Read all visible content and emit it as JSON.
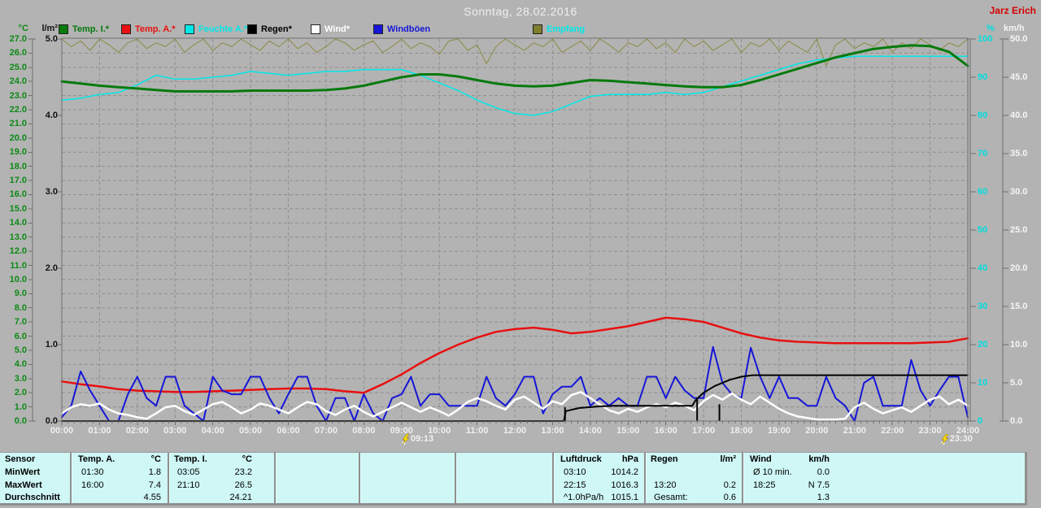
{
  "header": {
    "title": "Sonntag, 28.02.2016",
    "watermark": "Jarz Erich"
  },
  "legend": {
    "items": [
      {
        "label": "Temp. I.*",
        "color": "#067a0c",
        "text_color": "#067a0c"
      },
      {
        "label": "Temp. A.*",
        "color": "#e81010",
        "text_color": "#e81010"
      },
      {
        "label": "Feuchte A.*",
        "color": "#00e8e8",
        "text_color": "#00e8e8"
      },
      {
        "label": "Regen*",
        "color": "#000000",
        "text_color": "#000000"
      },
      {
        "label": "Wind*",
        "color": "#ffffff",
        "text_color": "#ffffff"
      },
      {
        "label": "Windböen",
        "color": "#1616d8",
        "text_color": "#1616d8"
      },
      {
        "label": "Empfang",
        "color": "#7e7e2e",
        "text_color": "#00e8e8"
      }
    ]
  },
  "axes": {
    "left_temp": {
      "unit": "°C",
      "min": 0,
      "max": 27,
      "step": 1,
      "decimals": 1,
      "color": "#0d8a16"
    },
    "left_rain": {
      "unit": "l/m²",
      "min": 0,
      "max": 5,
      "step": 1,
      "decimals": 1,
      "color": "#111111"
    },
    "right_pct": {
      "unit": "%",
      "min": 0,
      "max": 100,
      "step": 10,
      "decimals": 0,
      "color": "#00dede"
    },
    "right_wind": {
      "unit": "km/h",
      "min": 0,
      "max": 50,
      "step": 5,
      "decimals": 1,
      "color": "#f5f5f5"
    },
    "x_time": {
      "min": 0,
      "max": 24,
      "step": 1,
      "suffix": ":00"
    }
  },
  "markers": [
    {
      "label": "09:13",
      "t": 9.22
    },
    {
      "label": "23:30",
      "t": 23.5
    }
  ],
  "chart_data": {
    "type": "line",
    "title": "Sonntag, 28.02.2016",
    "x_unit": "hours",
    "x_range": [
      0,
      24
    ],
    "grid": {
      "x_step_hours": 1,
      "y_step_temp_c": 1
    },
    "scales": {
      "temp": {
        "min": 0,
        "max": 27
      },
      "rain": {
        "min": 0,
        "max": 5
      },
      "pct": {
        "min": 0,
        "max": 100
      },
      "wind": {
        "min": 0,
        "max": 50
      }
    },
    "series": [
      {
        "name": "Empfang",
        "scale": "pct",
        "color": "#8b8b44",
        "width": 1,
        "interval_min": 15,
        "values": [
          100,
          98,
          99.5,
          97,
          100,
          98.5,
          96.5,
          99,
          100,
          97.5,
          99,
          98,
          100,
          96.5,
          98.5,
          100,
          97,
          99,
          98,
          100,
          98.5,
          97,
          99.5,
          98,
          100,
          97.5,
          99,
          96.5,
          98,
          100,
          99,
          97,
          98.5,
          99.5,
          96.5,
          98,
          100,
          97.5,
          99,
          98,
          96,
          99.5,
          100,
          97,
          98.5,
          93.5,
          98,
          100,
          98.5,
          97,
          99,
          98,
          100,
          96.5,
          98,
          99.5,
          97,
          100,
          98.5,
          96.5,
          99,
          98,
          100,
          97.5,
          99,
          96.5,
          100,
          98,
          99.5,
          97,
          98.5,
          100,
          96.5,
          99,
          98,
          100,
          97,
          99.5,
          98,
          96.5,
          100,
          93,
          98.5,
          100,
          97.5,
          99,
          98,
          100,
          96.5,
          99,
          97.5,
          100,
          98.5,
          97,
          99,
          98,
          100
        ]
      },
      {
        "name": "Feuchte A.",
        "scale": "pct",
        "color": "#00e8e8",
        "width": 1.5,
        "interval_min": 30,
        "values": [
          84,
          84.5,
          85.5,
          86,
          88,
          90.5,
          89.5,
          89.5,
          90,
          90.5,
          91.5,
          91,
          90.5,
          91,
          91.5,
          91.5,
          92,
          92,
          92,
          90.5,
          88.5,
          86.5,
          84,
          82,
          80.5,
          80,
          81,
          83,
          85,
          85.5,
          85.5,
          85.5,
          86,
          85.5,
          86,
          87.5,
          89,
          90.5,
          92,
          93.5,
          94.5,
          95,
          95.5,
          95.5,
          95.5,
          95.5,
          95.5,
          95.5,
          95.5
        ]
      },
      {
        "name": "Temp. I.",
        "scale": "temp",
        "color": "#067a0c",
        "width": 3,
        "interval_min": 30,
        "values": [
          24.0,
          23.85,
          23.7,
          23.6,
          23.5,
          23.4,
          23.3,
          23.3,
          23.3,
          23.3,
          23.35,
          23.35,
          23.35,
          23.35,
          23.4,
          23.5,
          23.7,
          24.0,
          24.3,
          24.5,
          24.5,
          24.35,
          24.1,
          23.85,
          23.7,
          23.65,
          23.7,
          23.9,
          24.1,
          24.05,
          23.95,
          23.85,
          23.75,
          23.65,
          23.6,
          23.6,
          23.75,
          24.1,
          24.5,
          24.9,
          25.3,
          25.7,
          26.0,
          26.3,
          26.45,
          26.55,
          26.5,
          26.1,
          25.1
        ]
      },
      {
        "name": "Temp. A.",
        "scale": "temp",
        "color": "#e81010",
        "width": 2.5,
        "interval_min": 30,
        "values": [
          2.8,
          2.6,
          2.45,
          2.25,
          2.15,
          2.1,
          2.05,
          2.05,
          2.1,
          2.15,
          2.2,
          2.25,
          2.3,
          2.3,
          2.25,
          2.1,
          2.0,
          2.6,
          3.3,
          4.1,
          4.8,
          5.4,
          5.9,
          6.3,
          6.5,
          6.6,
          6.45,
          6.2,
          6.3,
          6.5,
          6.7,
          7.0,
          7.3,
          7.2,
          7.0,
          6.6,
          6.2,
          5.9,
          5.7,
          5.6,
          5.55,
          5.5,
          5.5,
          5.5,
          5.5,
          5.5,
          5.55,
          5.6,
          5.85
        ]
      },
      {
        "name": "Windböen",
        "scale": "wind",
        "color": "#1616d8",
        "width": 2,
        "interval_min": 15,
        "values": [
          0.5,
          2,
          6.5,
          4,
          2,
          0,
          0,
          3.5,
          5.8,
          3,
          2,
          5.8,
          5.8,
          2,
          1,
          0,
          5.8,
          4,
          3.5,
          3.5,
          5.8,
          5.8,
          3,
          1,
          3.5,
          5.8,
          5.8,
          2,
          0,
          3,
          3,
          0,
          3.5,
          1,
          0,
          3,
          3.5,
          5.8,
          2,
          3.5,
          3.5,
          2,
          2,
          2,
          2,
          5.8,
          3,
          2,
          3.5,
          5.8,
          5.8,
          1,
          3.5,
          4.5,
          4.5,
          5.8,
          2,
          3,
          2,
          3,
          2,
          2,
          5.8,
          5.8,
          3,
          5.8,
          4,
          3,
          3,
          9.7,
          5,
          3.5,
          3,
          9.6,
          5.8,
          3,
          5.8,
          3,
          3,
          2,
          2,
          5.8,
          3,
          2,
          0,
          5,
          5.8,
          2,
          2,
          2,
          8,
          4,
          2,
          4,
          5.8,
          5.8,
          0.5
        ]
      },
      {
        "name": "Wind",
        "scale": "wind",
        "color": "#ffffff",
        "width": 2.5,
        "interval_min": 15,
        "values": [
          1.0,
          1.8,
          2.2,
          2.0,
          2.3,
          1.5,
          1.0,
          0.8,
          0.5,
          0.3,
          1.0,
          1.8,
          2.0,
          1.3,
          0.8,
          1.5,
          2.2,
          2.5,
          1.8,
          1.0,
          1.5,
          2.3,
          2.0,
          1.5,
          1.0,
          1.8,
          2.5,
          2.2,
          1.3,
          0.8,
          1.5,
          2.0,
          1.2,
          0.6,
          1.2,
          1.8,
          2.4,
          1.8,
          1.2,
          1.8,
          1.3,
          0.7,
          1.5,
          2.5,
          3.0,
          2.6,
          2.0,
          1.5,
          2.8,
          3.2,
          2.4,
          1.6,
          2.6,
          2.2,
          3.4,
          3.8,
          3.0,
          2.2,
          1.4,
          1.0,
          1.6,
          1.2,
          1.8,
          2.2,
          1.8,
          2.4,
          2.0,
          1.4,
          2.6,
          3.4,
          2.8,
          3.6,
          2.8,
          2.2,
          3.2,
          2.4,
          1.6,
          1.0,
          0.6,
          0.4,
          0.2,
          0.2,
          0.2,
          0.3,
          1.8,
          2.4,
          1.6,
          1.0,
          1.4,
          1.8,
          1.2,
          2.0,
          2.8,
          3.2,
          2.2,
          2.8,
          2.0
        ]
      },
      {
        "name": "Regen",
        "scale": "rain",
        "color": "#000000",
        "width": 2,
        "points": [
          [
            0,
            0
          ],
          [
            13.3,
            0
          ],
          [
            13.35,
            0.13
          ],
          [
            13.7,
            0.17
          ],
          [
            14.2,
            0.19
          ],
          [
            14.6,
            0.2
          ],
          [
            16.7,
            0.2
          ],
          [
            16.8,
            0.28
          ],
          [
            17.0,
            0.37
          ],
          [
            17.3,
            0.46
          ],
          [
            17.7,
            0.54
          ],
          [
            18.0,
            0.58
          ],
          [
            18.3,
            0.6
          ],
          [
            24,
            0.6
          ]
        ]
      }
    ],
    "rain_event_bars": [
      [
        13.33,
        0.18
      ],
      [
        16.83,
        0.3
      ],
      [
        17.42,
        0.22
      ]
    ]
  },
  "summary_table": {
    "row_labels": [
      "Sensor",
      "MinWert",
      "MaxWert",
      "Durchschnitt"
    ],
    "columns": [
      {
        "name": "temp_a",
        "title": "Temp. A.",
        "unit": "°C",
        "rows": [
          [
            "01:30",
            "1.8"
          ],
          [
            "16:00",
            "7.4"
          ],
          [
            "",
            "4.55"
          ]
        ]
      },
      {
        "name": "temp_i",
        "title": "Temp. I.",
        "unit": "°C",
        "rows": [
          [
            "03:05",
            "23.2"
          ],
          [
            "21:10",
            "26.5"
          ],
          [
            "",
            "24.21"
          ]
        ]
      },
      {
        "name": "luftdruck",
        "title": "Luftdruck",
        "unit": "hPa",
        "rows": [
          [
            "03:10",
            "1014.2"
          ],
          [
            "22:15",
            "1016.3"
          ],
          [
            "^1.0hPa/h",
            "1015.1"
          ]
        ]
      },
      {
        "name": "regen",
        "title": "Regen",
        "unit": "l/m²",
        "rows": [
          [
            "",
            ""
          ],
          [
            "13:20",
            "0.2"
          ],
          [
            "Gesamt:",
            "0.6"
          ]
        ]
      },
      {
        "name": "wind",
        "title": "Wind",
        "unit": "km/h",
        "rows": [
          [
            "Ø 10 min.",
            "0.0"
          ],
          [
            "18:25",
            "N 7.5"
          ],
          [
            "",
            "1.3"
          ]
        ]
      }
    ]
  }
}
